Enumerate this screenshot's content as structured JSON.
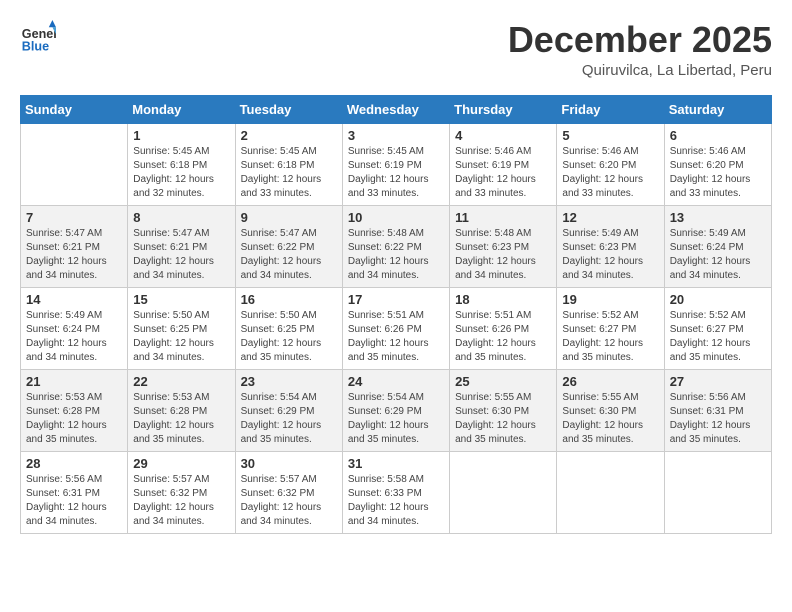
{
  "header": {
    "logo_line1": "General",
    "logo_line2": "Blue",
    "title": "December 2025",
    "subtitle": "Quiruvilca, La Libertad, Peru"
  },
  "columns": [
    "Sunday",
    "Monday",
    "Tuesday",
    "Wednesday",
    "Thursday",
    "Friday",
    "Saturday"
  ],
  "weeks": [
    [
      {
        "day": "",
        "info": ""
      },
      {
        "day": "1",
        "info": "Sunrise: 5:45 AM\nSunset: 6:18 PM\nDaylight: 12 hours\nand 32 minutes."
      },
      {
        "day": "2",
        "info": "Sunrise: 5:45 AM\nSunset: 6:18 PM\nDaylight: 12 hours\nand 33 minutes."
      },
      {
        "day": "3",
        "info": "Sunrise: 5:45 AM\nSunset: 6:19 PM\nDaylight: 12 hours\nand 33 minutes."
      },
      {
        "day": "4",
        "info": "Sunrise: 5:46 AM\nSunset: 6:19 PM\nDaylight: 12 hours\nand 33 minutes."
      },
      {
        "day": "5",
        "info": "Sunrise: 5:46 AM\nSunset: 6:20 PM\nDaylight: 12 hours\nand 33 minutes."
      },
      {
        "day": "6",
        "info": "Sunrise: 5:46 AM\nSunset: 6:20 PM\nDaylight: 12 hours\nand 33 minutes."
      }
    ],
    [
      {
        "day": "7",
        "info": "Sunrise: 5:47 AM\nSunset: 6:21 PM\nDaylight: 12 hours\nand 34 minutes."
      },
      {
        "day": "8",
        "info": "Sunrise: 5:47 AM\nSunset: 6:21 PM\nDaylight: 12 hours\nand 34 minutes."
      },
      {
        "day": "9",
        "info": "Sunrise: 5:47 AM\nSunset: 6:22 PM\nDaylight: 12 hours\nand 34 minutes."
      },
      {
        "day": "10",
        "info": "Sunrise: 5:48 AM\nSunset: 6:22 PM\nDaylight: 12 hours\nand 34 minutes."
      },
      {
        "day": "11",
        "info": "Sunrise: 5:48 AM\nSunset: 6:23 PM\nDaylight: 12 hours\nand 34 minutes."
      },
      {
        "day": "12",
        "info": "Sunrise: 5:49 AM\nSunset: 6:23 PM\nDaylight: 12 hours\nand 34 minutes."
      },
      {
        "day": "13",
        "info": "Sunrise: 5:49 AM\nSunset: 6:24 PM\nDaylight: 12 hours\nand 34 minutes."
      }
    ],
    [
      {
        "day": "14",
        "info": "Sunrise: 5:49 AM\nSunset: 6:24 PM\nDaylight: 12 hours\nand 34 minutes."
      },
      {
        "day": "15",
        "info": "Sunrise: 5:50 AM\nSunset: 6:25 PM\nDaylight: 12 hours\nand 34 minutes."
      },
      {
        "day": "16",
        "info": "Sunrise: 5:50 AM\nSunset: 6:25 PM\nDaylight: 12 hours\nand 35 minutes."
      },
      {
        "day": "17",
        "info": "Sunrise: 5:51 AM\nSunset: 6:26 PM\nDaylight: 12 hours\nand 35 minutes."
      },
      {
        "day": "18",
        "info": "Sunrise: 5:51 AM\nSunset: 6:26 PM\nDaylight: 12 hours\nand 35 minutes."
      },
      {
        "day": "19",
        "info": "Sunrise: 5:52 AM\nSunset: 6:27 PM\nDaylight: 12 hours\nand 35 minutes."
      },
      {
        "day": "20",
        "info": "Sunrise: 5:52 AM\nSunset: 6:27 PM\nDaylight: 12 hours\nand 35 minutes."
      }
    ],
    [
      {
        "day": "21",
        "info": "Sunrise: 5:53 AM\nSunset: 6:28 PM\nDaylight: 12 hours\nand 35 minutes."
      },
      {
        "day": "22",
        "info": "Sunrise: 5:53 AM\nSunset: 6:28 PM\nDaylight: 12 hours\nand 35 minutes."
      },
      {
        "day": "23",
        "info": "Sunrise: 5:54 AM\nSunset: 6:29 PM\nDaylight: 12 hours\nand 35 minutes."
      },
      {
        "day": "24",
        "info": "Sunrise: 5:54 AM\nSunset: 6:29 PM\nDaylight: 12 hours\nand 35 minutes."
      },
      {
        "day": "25",
        "info": "Sunrise: 5:55 AM\nSunset: 6:30 PM\nDaylight: 12 hours\nand 35 minutes."
      },
      {
        "day": "26",
        "info": "Sunrise: 5:55 AM\nSunset: 6:30 PM\nDaylight: 12 hours\nand 35 minutes."
      },
      {
        "day": "27",
        "info": "Sunrise: 5:56 AM\nSunset: 6:31 PM\nDaylight: 12 hours\nand 35 minutes."
      }
    ],
    [
      {
        "day": "28",
        "info": "Sunrise: 5:56 AM\nSunset: 6:31 PM\nDaylight: 12 hours\nand 34 minutes."
      },
      {
        "day": "29",
        "info": "Sunrise: 5:57 AM\nSunset: 6:32 PM\nDaylight: 12 hours\nand 34 minutes."
      },
      {
        "day": "30",
        "info": "Sunrise: 5:57 AM\nSunset: 6:32 PM\nDaylight: 12 hours\nand 34 minutes."
      },
      {
        "day": "31",
        "info": "Sunrise: 5:58 AM\nSunset: 6:33 PM\nDaylight: 12 hours\nand 34 minutes."
      },
      {
        "day": "",
        "info": ""
      },
      {
        "day": "",
        "info": ""
      },
      {
        "day": "",
        "info": ""
      }
    ]
  ]
}
